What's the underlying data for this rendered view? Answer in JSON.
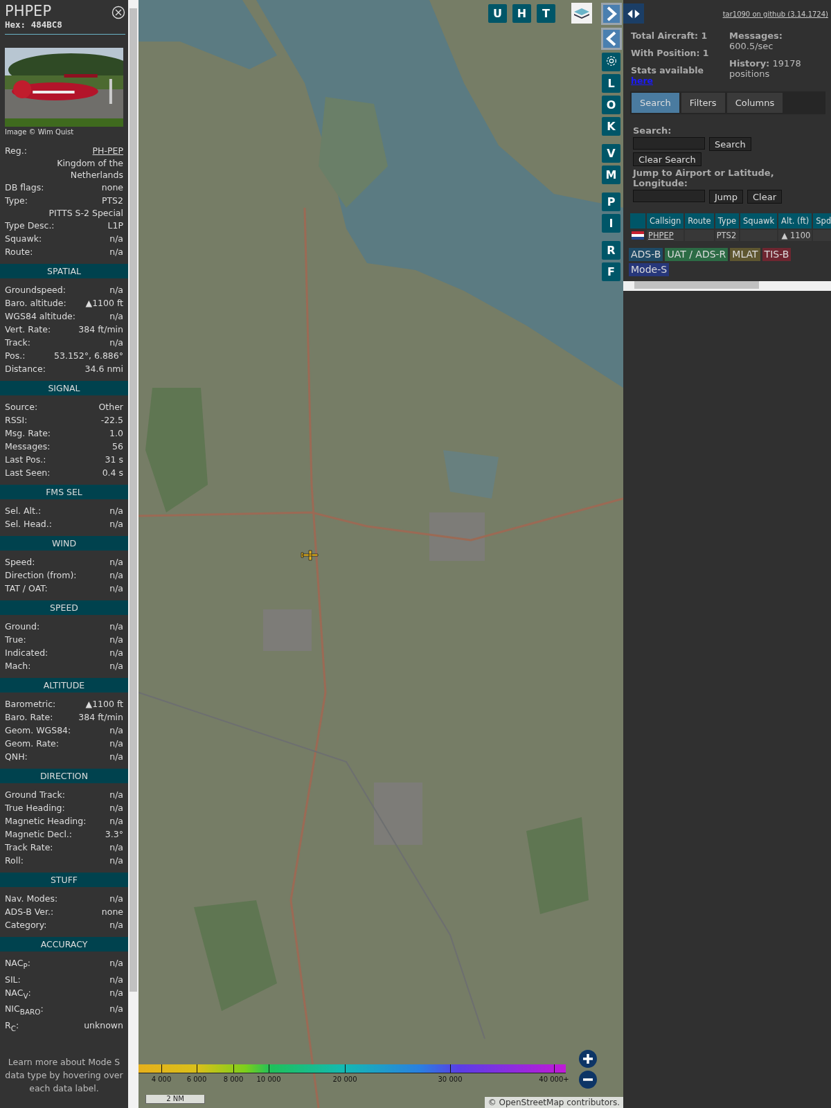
{
  "detail": {
    "title": "PHPEP",
    "hex_label": "Hex:",
    "hex": "484BC8",
    "photo": {
      "kind": "picture"
    },
    "photo_credit": "Image © Wim Quist",
    "info_rows": [
      {
        "kind": "link",
        "label": "Reg.:",
        "value": "PH-PEP"
      },
      {
        "kind": "full",
        "value": "Kingdom of the Netherlands"
      },
      {
        "kind": "pair",
        "label": "DB flags:",
        "value": "none"
      },
      {
        "kind": "pair",
        "label": "Type:",
        "value": "PTS2"
      },
      {
        "kind": "full",
        "value": "PITTS S-2 Special"
      },
      {
        "kind": "pair",
        "label": "Type Desc.:",
        "value": "L1P"
      },
      {
        "kind": "pair",
        "label": "Squawk:",
        "value": "n/a"
      },
      {
        "kind": "pair",
        "label": "Route:",
        "value": "n/a"
      }
    ],
    "sections": [
      {
        "title": "SPATIAL",
        "rows": [
          {
            "label": "Groundspeed:",
            "value": "n/a"
          },
          {
            "label": "Baro. altitude:",
            "value": "▲1100 ft"
          },
          {
            "label": "WGS84 altitude:",
            "value": "n/a"
          },
          {
            "label": "Vert. Rate:",
            "value": "384 ft/min"
          },
          {
            "label": "Track:",
            "value": "n/a"
          },
          {
            "label": "Pos.:",
            "value": "53.152°, 6.886°"
          },
          {
            "label": "Distance:",
            "value": "34.6 nmi"
          }
        ]
      },
      {
        "title": "SIGNAL",
        "rows": [
          {
            "label": "Source:",
            "value": "Other"
          },
          {
            "label": "RSSI:",
            "value": "-22.5"
          },
          {
            "label": "Msg. Rate:",
            "value": "1.0"
          },
          {
            "label": "Messages:",
            "value": "56"
          },
          {
            "label": "Last Pos.:",
            "value": "31 s"
          },
          {
            "label": "Last Seen:",
            "value": "0.4 s"
          }
        ]
      },
      {
        "title": "FMS SEL",
        "rows": [
          {
            "label": "Sel. Alt.:",
            "value": "n/a"
          },
          {
            "label": "Sel. Head.:",
            "value": "n/a"
          }
        ]
      },
      {
        "title": "WIND",
        "rows": [
          {
            "label": "Speed:",
            "value": "n/a"
          },
          {
            "label": "Direction (from):",
            "value": "n/a"
          },
          {
            "label": "TAT / OAT:",
            "value": "n/a"
          }
        ]
      },
      {
        "title": "SPEED",
        "rows": [
          {
            "label": "Ground:",
            "value": "n/a"
          },
          {
            "label": "True:",
            "value": "n/a"
          },
          {
            "label": "Indicated:",
            "value": "n/a"
          },
          {
            "label": "Mach:",
            "value": "n/a"
          }
        ]
      },
      {
        "title": "ALTITUDE",
        "rows": [
          {
            "label": "Barometric:",
            "value": "▲1100 ft"
          },
          {
            "label": "Baro. Rate:",
            "value": "384 ft/min"
          },
          {
            "label": "Geom. WGS84:",
            "value": "n/a"
          },
          {
            "label": "Geom. Rate:",
            "value": "n/a"
          },
          {
            "label": "QNH:",
            "value": "n/a"
          }
        ]
      },
      {
        "title": "DIRECTION",
        "rows": [
          {
            "label": "Ground Track:",
            "value": "n/a"
          },
          {
            "label": "True Heading:",
            "value": "n/a"
          },
          {
            "label": "Magnetic Heading:",
            "value": "n/a"
          },
          {
            "label": "Magnetic Decl.:",
            "value": "3.3°"
          },
          {
            "label": "Track Rate:",
            "value": "n/a"
          },
          {
            "label": "Roll:",
            "value": "n/a"
          }
        ]
      },
      {
        "title": "STUFF",
        "rows": [
          {
            "label": "Nav. Modes:",
            "value": "n/a"
          },
          {
            "label": "ADS-B Ver.:",
            "value": "none"
          },
          {
            "label": "Category:",
            "value": "n/a"
          }
        ]
      },
      {
        "title": "ACCURACY",
        "rows": [
          {
            "label": "NAC$_{P}$:",
            "value": "n/a"
          },
          {
            "label": "SIL:",
            "value": "n/a"
          },
          {
            "label": "NAC$_{V}$:",
            "value": "n/a"
          },
          {
            "label": "NIC$_{BARO}$:",
            "value": "n/a"
          },
          {
            "label": "R$_{C}$:",
            "value": "unknown"
          }
        ]
      }
    ],
    "footnote": "Learn more about Mode S data type by hovering over each data label."
  },
  "map": {
    "tile": {
      "kind": "picture"
    },
    "top_buttons": [
      "U",
      "H",
      "T"
    ],
    "side_buttons": [
      {
        "kind": "next"
      },
      {
        "kind": "prev"
      },
      {
        "kind": "settings"
      },
      {
        "kind": "letter",
        "label": "L"
      },
      {
        "kind": "letter",
        "label": "O"
      },
      {
        "kind": "letter",
        "label": "K"
      },
      {
        "kind": "letter",
        "label": "V"
      },
      {
        "kind": "letter",
        "label": "M"
      },
      {
        "kind": "letter",
        "label": "P"
      },
      {
        "kind": "letter",
        "label": "I"
      },
      {
        "kind": "letter",
        "label": "R"
      },
      {
        "kind": "letter",
        "label": "F"
      }
    ],
    "altitude_legend": [
      "4 000",
      "6 000",
      "8 000",
      "10 000",
      "20 000",
      "30 000",
      "40 000+"
    ],
    "scale": "2 NM",
    "attribution": "© OpenStreetMap contributors."
  },
  "panel": {
    "github_link": "tar1090 on github (3.14.1724)",
    "stats": {
      "total": "Total Aircraft: 1",
      "with_position": "With Position: 1",
      "stats_text": "Stats available",
      "stats_link": "here",
      "messages_label": "Messages:",
      "messages": "600.5/sec",
      "history_label": "History:",
      "history": "19178 positions"
    },
    "tabs": [
      {
        "label": "Search",
        "selected": true
      },
      {
        "label": "Filters",
        "selected": false
      },
      {
        "label": "Columns",
        "selected": false
      }
    ],
    "search_label": "Search:",
    "search_button": "Search",
    "clear_search": "Clear Search",
    "jump_label": "Jump to Airport or Latitude, Longitude:",
    "jump_button": "Jump",
    "clear_button": "Clear",
    "table": {
      "columns": [
        "Callsign",
        "Route",
        "Type",
        "Squawk",
        "Alt. (ft)",
        "Spd"
      ],
      "rows": [
        {
          "callsign": "PHPEP",
          "type": "PTS2",
          "altitude": "▲ 1100"
        }
      ]
    },
    "source_tags": [
      {
        "label": "ADS-B",
        "color": "#1e4a66"
      },
      {
        "label": "UAT / ADS-R",
        "color": "#2c6b45"
      },
      {
        "label": "MLAT",
        "color": "#5e5630"
      },
      {
        "label": "TIS-B",
        "color": "#6e2630"
      },
      {
        "label": "Mode-S",
        "color": "#27377a"
      }
    ]
  }
}
